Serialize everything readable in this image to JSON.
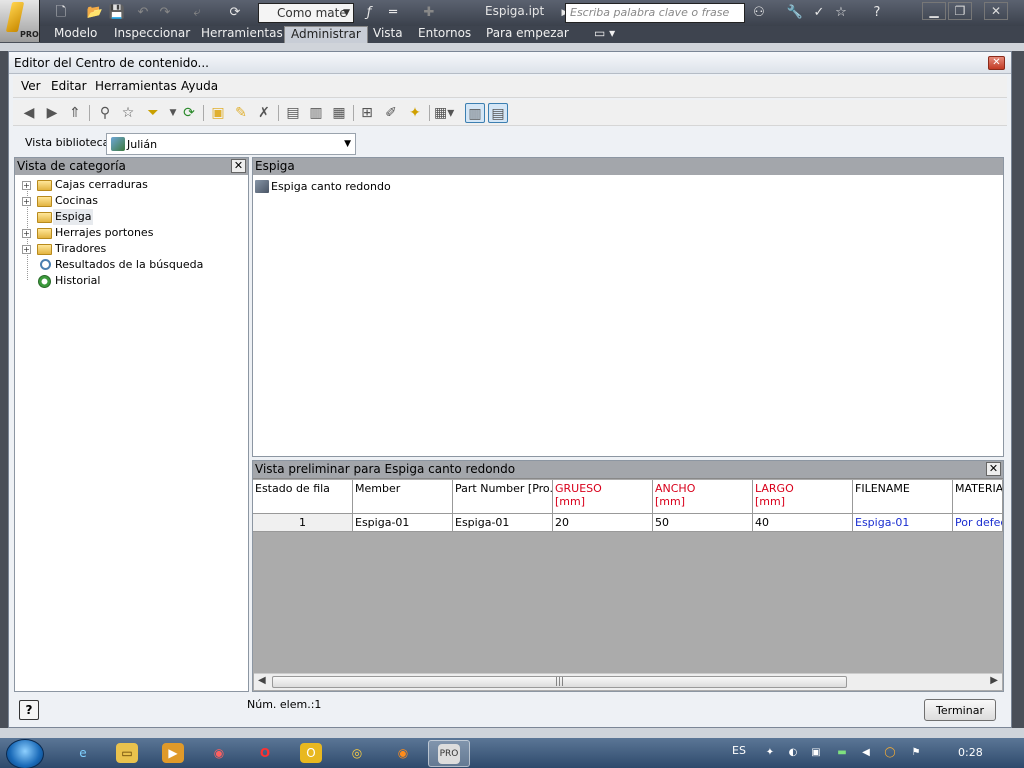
{
  "app": {
    "logo_badge": "PRO",
    "style_combo": "Como mate",
    "document_title": "Espiga.ipt",
    "search_placeholder": "Escriba palabra clave o frase"
  },
  "ribbon": {
    "tabs": [
      "Modelo",
      "Inspeccionar",
      "Herramientas",
      "Administrar",
      "Vista",
      "Entornos",
      "Para empezar"
    ],
    "active_tab": "Administrar"
  },
  "dialog": {
    "title": "Editor del Centro de contenido...",
    "menu": [
      "Ver",
      "Editar",
      "Herramientas",
      "Ayuda"
    ],
    "library_label": "Vista biblioteca:",
    "library_value": "Julián",
    "category_header": "Vista de categoría",
    "tree": [
      {
        "label": "Cajas cerraduras",
        "expandable": true
      },
      {
        "label": "Cocinas",
        "expandable": true
      },
      {
        "label": "Espiga",
        "expandable": false,
        "selected": true
      },
      {
        "label": "Herrajes portones",
        "expandable": true
      },
      {
        "label": "Tiradores",
        "expandable": true
      },
      {
        "label": "Resultados de la búsqueda",
        "expandable": false,
        "icon": "search-icon"
      },
      {
        "label": "Historial",
        "expandable": false,
        "icon": "history-icon"
      }
    ],
    "content_header": "Espiga",
    "content_item": "Espiga canto redondo",
    "preview_header": "Vista preliminar para Espiga canto redondo",
    "grid": {
      "columns": [
        {
          "label": "Estado de fila",
          "unit": ""
        },
        {
          "label": "Member",
          "unit": ""
        },
        {
          "label": "Part Number [Pro...",
          "unit": ""
        },
        {
          "label": "GRUESO",
          "unit": "[mm]"
        },
        {
          "label": "ANCHO",
          "unit": "[mm]"
        },
        {
          "label": "LARGO",
          "unit": "[mm]"
        },
        {
          "label": "FILENAME",
          "unit": ""
        },
        {
          "label": "MATERIAL",
          "unit": ""
        }
      ],
      "rows": [
        [
          "1",
          "Espiga-01",
          "Espiga-01",
          "20",
          "50",
          "40",
          "Espiga-01",
          "Por defect"
        ]
      ]
    },
    "count_text": "Núm. elem.:1",
    "finish_label": "Terminar",
    "help_label": "?"
  },
  "taskbar": {
    "language": "ES",
    "clock": "0:28"
  },
  "colors": {
    "parameter_red": "#d8001b",
    "link_blue": "#1a2ed0",
    "pane_header": "#a3a6ab"
  }
}
